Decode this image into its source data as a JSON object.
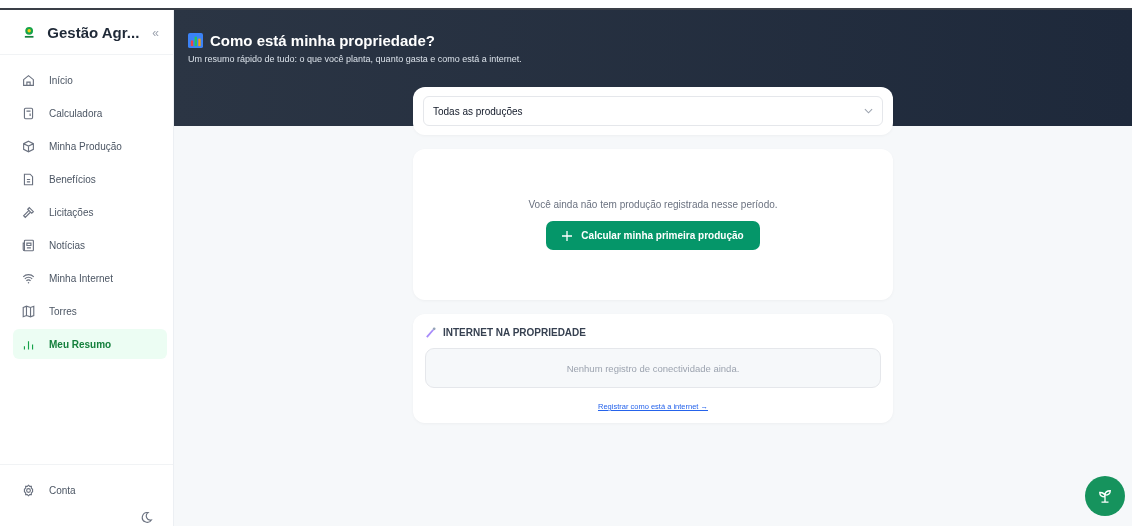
{
  "sidebar": {
    "brand": "Gestão Agr...",
    "collapse_glyph": "«",
    "items": [
      {
        "label": "Início",
        "selected": false
      },
      {
        "label": "Calculadora",
        "selected": false
      },
      {
        "label": "Minha Produção",
        "selected": false
      },
      {
        "label": "Benefícios",
        "selected": false
      },
      {
        "label": "Licitações",
        "selected": false
      },
      {
        "label": "Notícias",
        "selected": false
      },
      {
        "label": "Minha Internet",
        "selected": false
      },
      {
        "label": "Torres",
        "selected": false
      },
      {
        "label": "Meu Resumo",
        "selected": true
      }
    ],
    "footer": [
      {
        "label": "Conta",
        "selected": false
      }
    ]
  },
  "header": {
    "title": "Como está minha propriedade?",
    "subtitle": "Um resumo rápido de tudo: o que você planta, quanto gasta e como está a internet."
  },
  "filter": {
    "value": "Todas as produções"
  },
  "production": {
    "message": "Você ainda não tem produção registrada nesse período.",
    "button": "Calcular minha primeira produção"
  },
  "internet": {
    "title": "INTERNET NA PROPRIEDADE",
    "empty": "Nenhum registro de conectividade ainda.",
    "link": "Registrar como está a internet →"
  }
}
